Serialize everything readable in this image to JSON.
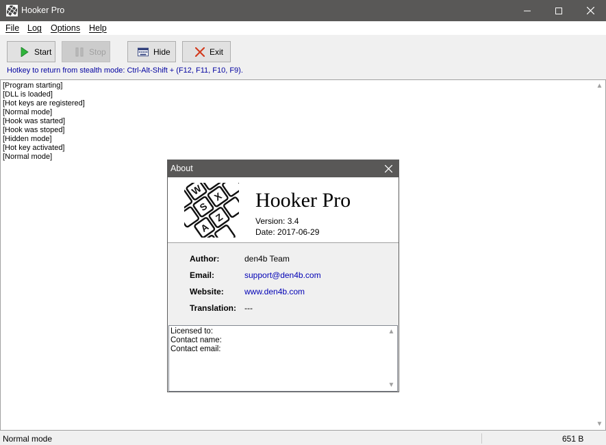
{
  "window": {
    "title": "Hooker Pro"
  },
  "menu": [
    "File",
    "Log",
    "Options",
    "Help"
  ],
  "toolbar": {
    "start_label": "Start",
    "stop_label": "Stop",
    "hide_label": "Hide",
    "exit_label": "Exit"
  },
  "hotkey_hint": "Hotkey to return from stealth mode: Ctrl-Alt-Shift + (F12, F11, F10, F9).",
  "log_lines": [
    "[Program starting]",
    "[DLL is loaded]",
    "[Hot keys are registered]",
    "[Normal mode]",
    "[Hook was started]",
    "[Hook was stoped]",
    "[Hidden mode]",
    "[Hot key activated]",
    "[Normal mode]"
  ],
  "statusbar": {
    "mode": "Normal mode",
    "size": "651 B"
  },
  "about": {
    "title": "About",
    "product": "Hooker Pro",
    "version": "Version: 3.4",
    "date": "Date: 2017-06-29",
    "author_label": "Author:",
    "author": "den4b Team",
    "email_label": "Email:",
    "email": "support@den4b.com",
    "website_label": "Website:",
    "website": "www.den4b.com",
    "translation_label": "Translation:",
    "translation": "---",
    "license_lines": [
      "Licensed to:",
      "Contact name:",
      "Contact email:"
    ]
  },
  "logo_keys": [
    "W",
    "S",
    "X",
    "A",
    "Z"
  ],
  "icons": {
    "app": "app-keyboard-icon",
    "start": "play-icon",
    "stop": "pause-icon",
    "hide": "keyboard-icon",
    "exit": "x-icon"
  },
  "colors": {
    "titlebar": "#595857",
    "hint_text": "#0000a0",
    "link": "#0000b5",
    "play_green": "#2fb43b",
    "exit_red": "#d23b1e"
  }
}
